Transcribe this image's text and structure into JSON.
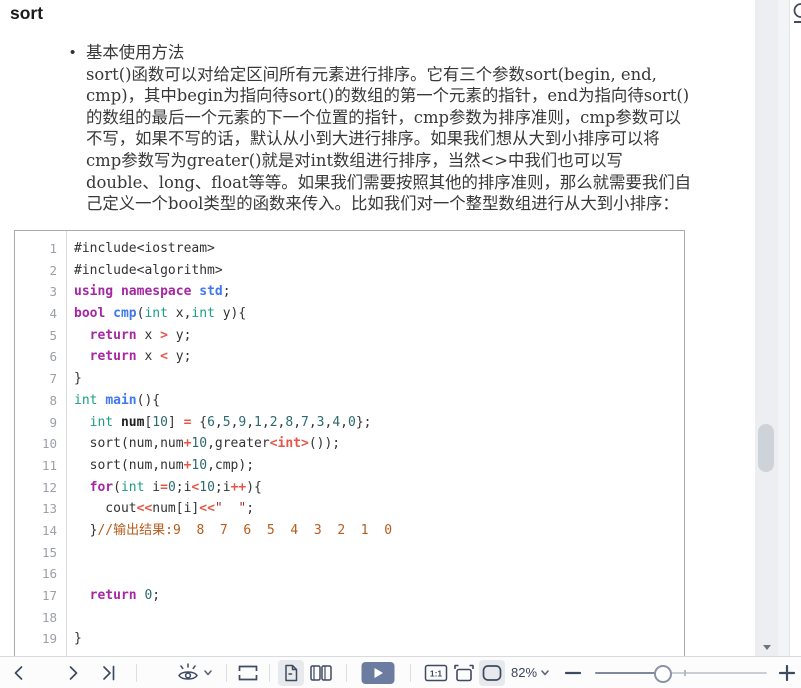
{
  "document": {
    "title": "sort",
    "bullet_glyph": "•",
    "bullet_heading": "基本使用方法",
    "paragraph": "sort()函数可以对给定区间所有元素进行排序。它有三个参数sort(begin, end, cmp)，其中begin为指向待sort()的数组的第一个元素的指针，end为指向待sort()的数组的最后一个元素的下一个位置的指针，cmp参数为排序准则，cmp参数可以不写，如果不写的话，默认从小到大进行排序。如果我们想从大到小排序可以将cmp参数写为greater()就是对int数组进行排序，当然<>中我们也可以写double、long、float等等。如果我们需要按照其他的排序准则，那么就需要我们自己定义一个bool类型的函数来传入。比如我们对一个整型数组进行从大到小排序："
  },
  "code": {
    "lines": [
      {
        "n": "1",
        "t": [
          [
            "p",
            "#include<iostream>"
          ]
        ]
      },
      {
        "n": "2",
        "t": [
          [
            "p",
            "#include<algorithm>"
          ]
        ]
      },
      {
        "n": "3",
        "t": [
          [
            "k",
            "using"
          ],
          [
            "p",
            " "
          ],
          [
            "k",
            "namespace"
          ],
          [
            "p",
            " "
          ],
          [
            "f",
            "std"
          ],
          [
            "p",
            ";"
          ]
        ]
      },
      {
        "n": "4",
        "t": [
          [
            "k",
            "bool"
          ],
          [
            "p",
            " "
          ],
          [
            "f",
            "cmp"
          ],
          [
            "p",
            "("
          ],
          [
            "t",
            "int"
          ],
          [
            "p",
            " x,"
          ],
          [
            "t",
            "int"
          ],
          [
            "p",
            " y){"
          ]
        ]
      },
      {
        "n": "5",
        "t": [
          [
            "p",
            "  "
          ],
          [
            "k",
            "return"
          ],
          [
            "p",
            " x "
          ],
          [
            "o",
            ">"
          ],
          [
            "p",
            " y;"
          ]
        ]
      },
      {
        "n": "6",
        "t": [
          [
            "p",
            "  "
          ],
          [
            "k",
            "return"
          ],
          [
            "p",
            " x "
          ],
          [
            "o",
            "<"
          ],
          [
            "p",
            " y;"
          ]
        ]
      },
      {
        "n": "7",
        "t": [
          [
            "p",
            "}"
          ]
        ]
      },
      {
        "n": "8",
        "t": [
          [
            "t",
            "int"
          ],
          [
            "p",
            " "
          ],
          [
            "f",
            "main"
          ],
          [
            "p",
            "(){"
          ]
        ]
      },
      {
        "n": "9",
        "t": [
          [
            "p",
            "  "
          ],
          [
            "t",
            "int"
          ],
          [
            "p",
            " "
          ],
          [
            "b",
            "num"
          ],
          [
            "p",
            "["
          ],
          [
            "n",
            "10"
          ],
          [
            "p",
            "] "
          ],
          [
            "o",
            "="
          ],
          [
            "p",
            " {"
          ],
          [
            "n",
            "6"
          ],
          [
            "p",
            ","
          ],
          [
            "n",
            "5"
          ],
          [
            "p",
            ","
          ],
          [
            "n",
            "9"
          ],
          [
            "p",
            ","
          ],
          [
            "n",
            "1"
          ],
          [
            "p",
            ","
          ],
          [
            "n",
            "2"
          ],
          [
            "p",
            ","
          ],
          [
            "n",
            "8"
          ],
          [
            "p",
            ","
          ],
          [
            "n",
            "7"
          ],
          [
            "p",
            ","
          ],
          [
            "n",
            "3"
          ],
          [
            "p",
            ","
          ],
          [
            "n",
            "4"
          ],
          [
            "p",
            ","
          ],
          [
            "n",
            "0"
          ],
          [
            "p",
            "};"
          ]
        ]
      },
      {
        "n": "10",
        "t": [
          [
            "p",
            "  sort(num,num"
          ],
          [
            "o",
            "+"
          ],
          [
            "n",
            "10"
          ],
          [
            "p",
            ",greater"
          ],
          [
            "o",
            "<int>"
          ],
          [
            "p",
            "());"
          ]
        ]
      },
      {
        "n": "11",
        "t": [
          [
            "p",
            "  sort(num,num"
          ],
          [
            "o",
            "+"
          ],
          [
            "n",
            "10"
          ],
          [
            "p",
            ",cmp);"
          ]
        ]
      },
      {
        "n": "12",
        "t": [
          [
            "p",
            "  "
          ],
          [
            "k",
            "for"
          ],
          [
            "p",
            "("
          ],
          [
            "t",
            "int"
          ],
          [
            "p",
            " i"
          ],
          [
            "o",
            "="
          ],
          [
            "n",
            "0"
          ],
          [
            "p",
            ";i"
          ],
          [
            "o",
            "<"
          ],
          [
            "n",
            "10"
          ],
          [
            "p",
            ";i"
          ],
          [
            "o",
            "++"
          ],
          [
            "p",
            "){"
          ]
        ]
      },
      {
        "n": "13",
        "t": [
          [
            "p",
            "    cout"
          ],
          [
            "o",
            "<<"
          ],
          [
            "p",
            "num[i]"
          ],
          [
            "o",
            "<<"
          ],
          [
            "s",
            "\"  \""
          ],
          [
            "p",
            ";"
          ]
        ]
      },
      {
        "n": "14",
        "t": [
          [
            "p",
            "  }"
          ],
          [
            "c",
            "//输出结果:9  8  7  6  5  4  3  2  1  0"
          ]
        ]
      },
      {
        "n": "15",
        "t": []
      },
      {
        "n": "16",
        "t": []
      },
      {
        "n": "17",
        "t": [
          [
            "p",
            "  "
          ],
          [
            "k",
            "return"
          ],
          [
            "p",
            " "
          ],
          [
            "n",
            "0"
          ],
          [
            "p",
            ";"
          ]
        ]
      },
      {
        "n": "18",
        "t": []
      },
      {
        "n": "19",
        "t": [
          [
            "p",
            "}"
          ]
        ]
      }
    ]
  },
  "toolbar": {
    "zoom_level": "82%",
    "actual_size_label": "1:1",
    "icons": [
      "previous-page",
      "next-page",
      "last-page",
      "appearance",
      "trim-margins",
      "single-page-view",
      "facing-pages-view",
      "presentation-mode",
      "actual-size",
      "fit-width",
      "fit-page",
      "zoom-out",
      "zoom-slider",
      "zoom-in"
    ]
  },
  "colors": {
    "icon": "#3e4a60",
    "play_button": "#6b7ca0",
    "code_keyword": "#a626a4",
    "code_function": "#4078f2",
    "code_type": "#1b9e85",
    "code_number": "#2d6a6e",
    "code_operator": "#e45649",
    "code_string": "#a0302e",
    "code_comment": "#b75c1c"
  }
}
